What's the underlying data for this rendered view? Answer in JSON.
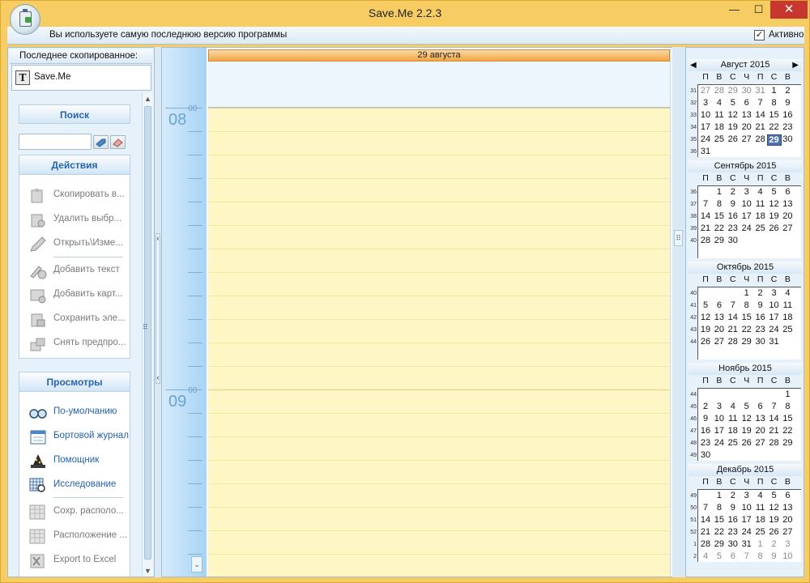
{
  "window": {
    "title": "Save.Me 2.2.3",
    "minimize": "—",
    "maximize": "☐",
    "close": "✕"
  },
  "infobar": {
    "message": "Вы используете самую последнюю версию программы",
    "active_checked": "✓",
    "active_label": "Активно"
  },
  "last_copied": {
    "header": "Последнее скопированное:",
    "icon_letter": "T",
    "item": "Save.Me"
  },
  "search": {
    "header": "Поиск",
    "value": ""
  },
  "actions": {
    "header": "Действия",
    "items": [
      {
        "label": "Скопировать в...",
        "icon": "copy-clipboard-icon"
      },
      {
        "label": "Удалить выбр...",
        "icon": "delete-clipboard-icon"
      },
      {
        "label": "Открыть\\Изме...",
        "icon": "pencil-icon"
      },
      {
        "label": "Добавить текст",
        "icon": "add-text-icon"
      },
      {
        "label": "Добавить карт...",
        "icon": "add-image-icon"
      },
      {
        "label": "Сохранить эле...",
        "icon": "save-item-icon"
      },
      {
        "label": "Снять предпро...",
        "icon": "unpin-icon"
      }
    ]
  },
  "views": {
    "header": "Просмотры",
    "items": [
      {
        "label": "По-умолчанию",
        "icon": "glasses-icon"
      },
      {
        "label": "Бортовой журнал",
        "icon": "logbook-icon"
      },
      {
        "label": "Помощник",
        "icon": "wizard-hat-icon"
      },
      {
        "label": "Исследование",
        "icon": "calendar-search-icon"
      },
      {
        "label": "Сохр. располо...",
        "icon": "save-layout-icon"
      },
      {
        "label": "Расположение ...",
        "icon": "layout-grid-icon"
      },
      {
        "label": "Export to Excel",
        "icon": "excel-icon"
      }
    ]
  },
  "day_view": {
    "date_header": "29 августа",
    "hours": [
      {
        "hour": "08",
        "minutes": "00"
      },
      {
        "hour": "09",
        "minutes": "00"
      }
    ]
  },
  "calendar": {
    "dow": [
      "П",
      "В",
      "С",
      "Ч",
      "П",
      "С",
      "В"
    ],
    "prev": "◀",
    "next": "▶",
    "months": [
      {
        "title": "Август 2015",
        "weeks": [
          {
            "wk": "31",
            "days": [
              "27",
              "28",
              "29",
              "30",
              "31",
              "1",
              "2"
            ],
            "other": [
              0,
              1,
              2,
              3,
              4
            ]
          },
          {
            "wk": "32",
            "days": [
              "3",
              "4",
              "5",
              "6",
              "7",
              "8",
              "9"
            ],
            "other": []
          },
          {
            "wk": "33",
            "days": [
              "10",
              "11",
              "12",
              "13",
              "14",
              "15",
              "16"
            ],
            "other": []
          },
          {
            "wk": "34",
            "days": [
              "17",
              "18",
              "19",
              "20",
              "21",
              "22",
              "23"
            ],
            "other": []
          },
          {
            "wk": "35",
            "days": [
              "24",
              "25",
              "26",
              "27",
              "28",
              "29",
              "30"
            ],
            "other": [],
            "today": 5
          },
          {
            "wk": "36",
            "days": [
              "31",
              "",
              "",
              "",
              "",
              "",
              ""
            ],
            "other": []
          }
        ]
      },
      {
        "title": "Сентябрь 2015",
        "weeks": [
          {
            "wk": "36",
            "days": [
              "",
              "1",
              "2",
              "3",
              "4",
              "5",
              "6"
            ],
            "other": []
          },
          {
            "wk": "37",
            "days": [
              "7",
              "8",
              "9",
              "10",
              "11",
              "12",
              "13"
            ],
            "other": []
          },
          {
            "wk": "38",
            "days": [
              "14",
              "15",
              "16",
              "17",
              "18",
              "19",
              "20"
            ],
            "other": []
          },
          {
            "wk": "39",
            "days": [
              "21",
              "22",
              "23",
              "24",
              "25",
              "26",
              "27"
            ],
            "other": []
          },
          {
            "wk": "40",
            "days": [
              "28",
              "29",
              "30",
              "",
              "",
              "",
              ""
            ],
            "other": []
          }
        ]
      },
      {
        "title": "Октябрь 2015",
        "weeks": [
          {
            "wk": "40",
            "days": [
              "",
              "",
              "",
              "1",
              "2",
              "3",
              "4"
            ],
            "other": []
          },
          {
            "wk": "41",
            "days": [
              "5",
              "6",
              "7",
              "8",
              "9",
              "10",
              "11"
            ],
            "other": []
          },
          {
            "wk": "42",
            "days": [
              "12",
              "13",
              "14",
              "15",
              "16",
              "17",
              "18"
            ],
            "other": []
          },
          {
            "wk": "43",
            "days": [
              "19",
              "20",
              "21",
              "22",
              "23",
              "24",
              "25"
            ],
            "other": []
          },
          {
            "wk": "44",
            "days": [
              "26",
              "27",
              "28",
              "29",
              "30",
              "31",
              ""
            ],
            "other": []
          }
        ]
      },
      {
        "title": "Ноябрь 2015",
        "weeks": [
          {
            "wk": "44",
            "days": [
              "",
              "",
              "",
              "",
              "",
              "",
              "1"
            ],
            "other": []
          },
          {
            "wk": "45",
            "days": [
              "2",
              "3",
              "4",
              "5",
              "6",
              "7",
              "8"
            ],
            "other": []
          },
          {
            "wk": "46",
            "days": [
              "9",
              "10",
              "11",
              "12",
              "13",
              "14",
              "15"
            ],
            "other": []
          },
          {
            "wk": "47",
            "days": [
              "16",
              "17",
              "18",
              "19",
              "20",
              "21",
              "22"
            ],
            "other": []
          },
          {
            "wk": "48",
            "days": [
              "23",
              "24",
              "25",
              "26",
              "27",
              "28",
              "29"
            ],
            "other": []
          },
          {
            "wk": "49",
            "days": [
              "30",
              "",
              "",
              "",
              "",
              "",
              ""
            ],
            "other": []
          }
        ]
      },
      {
        "title": "Декабрь 2015",
        "weeks": [
          {
            "wk": "49",
            "days": [
              "",
              "1",
              "2",
              "3",
              "4",
              "5",
              "6"
            ],
            "other": []
          },
          {
            "wk": "50",
            "days": [
              "7",
              "8",
              "9",
              "10",
              "11",
              "12",
              "13"
            ],
            "other": []
          },
          {
            "wk": "51",
            "days": [
              "14",
              "15",
              "16",
              "17",
              "18",
              "19",
              "20"
            ],
            "other": []
          },
          {
            "wk": "52",
            "days": [
              "21",
              "22",
              "23",
              "24",
              "25",
              "26",
              "27"
            ],
            "other": []
          },
          {
            "wk": "1",
            "days": [
              "28",
              "29",
              "30",
              "31",
              "1",
              "2",
              "3"
            ],
            "other": [
              4,
              5,
              6
            ]
          },
          {
            "wk": "2",
            "days": [
              "4",
              "5",
              "6",
              "7",
              "8",
              "9",
              "10"
            ],
            "other": [
              0,
              1,
              2,
              3,
              4,
              5,
              6
            ]
          }
        ]
      }
    ]
  }
}
